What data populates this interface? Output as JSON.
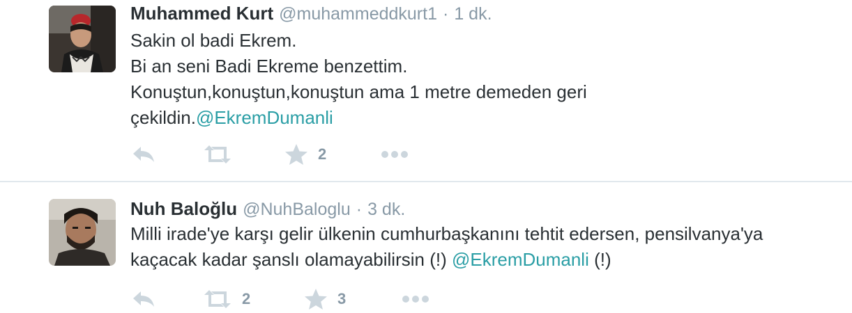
{
  "tweets": [
    {
      "name": "Muhammed Kurt",
      "handle": "@muhammeddkurt1",
      "time": "1 dk.",
      "lines": [
        "Sakin ol badi Ekrem.",
        "Bi an seni Badi Ekreme benzettim.",
        "Konuştun,konuştun,konuştun ama 1 metre demeden geri"
      ],
      "last_line_text": "çekildin.",
      "mention": "@EkremDumanli",
      "retweet_count": "",
      "favorite_count": "2"
    },
    {
      "name": "Nuh Baloğlu",
      "handle": "@NuhBaloglu",
      "time": "3 dk.",
      "lines": [
        "Milli irade'ye karşı gelir ülkenin cumhurbaşkanını tehtit edersen, pensilvanya'ya"
      ],
      "last_line_text": "kaçacak kadar şanslı olamayabilirsin (!) ",
      "mention": "@EkremDumanli",
      "trailing_text": " (!)",
      "retweet_count": "2",
      "favorite_count": "3"
    }
  ],
  "separator": "·",
  "colors": {
    "text": "#292f33",
    "meta": "#8899a6",
    "mention": "#2a9ea5",
    "icon": "#ccd6dd",
    "divider": "#e1e8ed"
  },
  "icons": [
    "reply-icon",
    "retweet-icon",
    "favorite-icon",
    "more-icon"
  ]
}
